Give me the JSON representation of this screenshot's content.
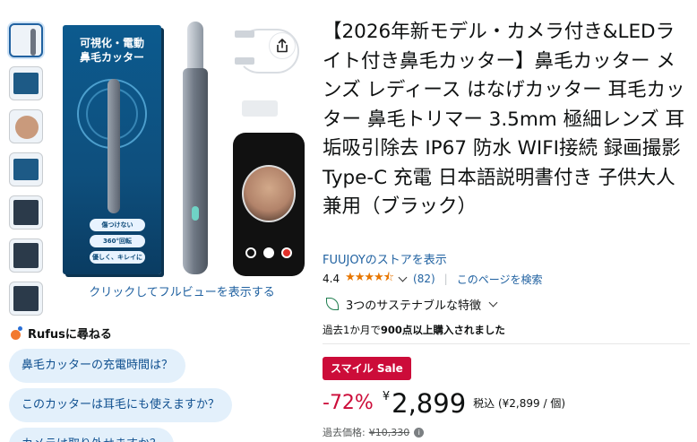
{
  "gallery": {
    "box_title_line1": "可視化・電動",
    "box_title_line2": "鼻毛カッター",
    "box_badges": [
      "傷つけない",
      "360°回転",
      "優しく、キレイに"
    ],
    "fullview_link": "クリックしてフルビューを表示する"
  },
  "rufus": {
    "title": "Rufusに尋ねる",
    "questions": [
      "鼻毛カッターの充電時間は？",
      "このカッターは耳毛にも使えますか？",
      "カメラは取り外せますか？"
    ]
  },
  "product": {
    "title": "【2026年新モデル・カメラ付き&LEDライト付き鼻毛カッター】鼻毛カッター メンズ レディース はなげカッター 耳毛カッター 鼻毛トリマー 3.5mm 極細レンズ 耳垢吸引除去 IP67 防水 WIFI接続 録画撮影 Type-C 充電 日本語説明書付き 子供大人兼用（ブラック）",
    "store_link": "FUUJOYのストアを表示",
    "rating_value": "4.4",
    "stars": "★★★★⯪",
    "review_count": "(82)",
    "search_link": "このページを検索",
    "sustainability": "3つのサステナブルな特徴",
    "bought_prefix": "過去1か月で",
    "bought_bold": "900点以上購入されました"
  },
  "pricing": {
    "sale_badge": "スマイル Sale",
    "discount": "-72%",
    "currency": "¥",
    "price": "2,899",
    "tax_unit": "税込 (¥2,899 / 個)",
    "list_label": "過去価格:",
    "list_price": "¥10,330"
  },
  "colors": {
    "link": "#2162a1",
    "sale_red": "#cc0c39",
    "star": "#e77600",
    "chip_bg": "#e3f0fb"
  }
}
